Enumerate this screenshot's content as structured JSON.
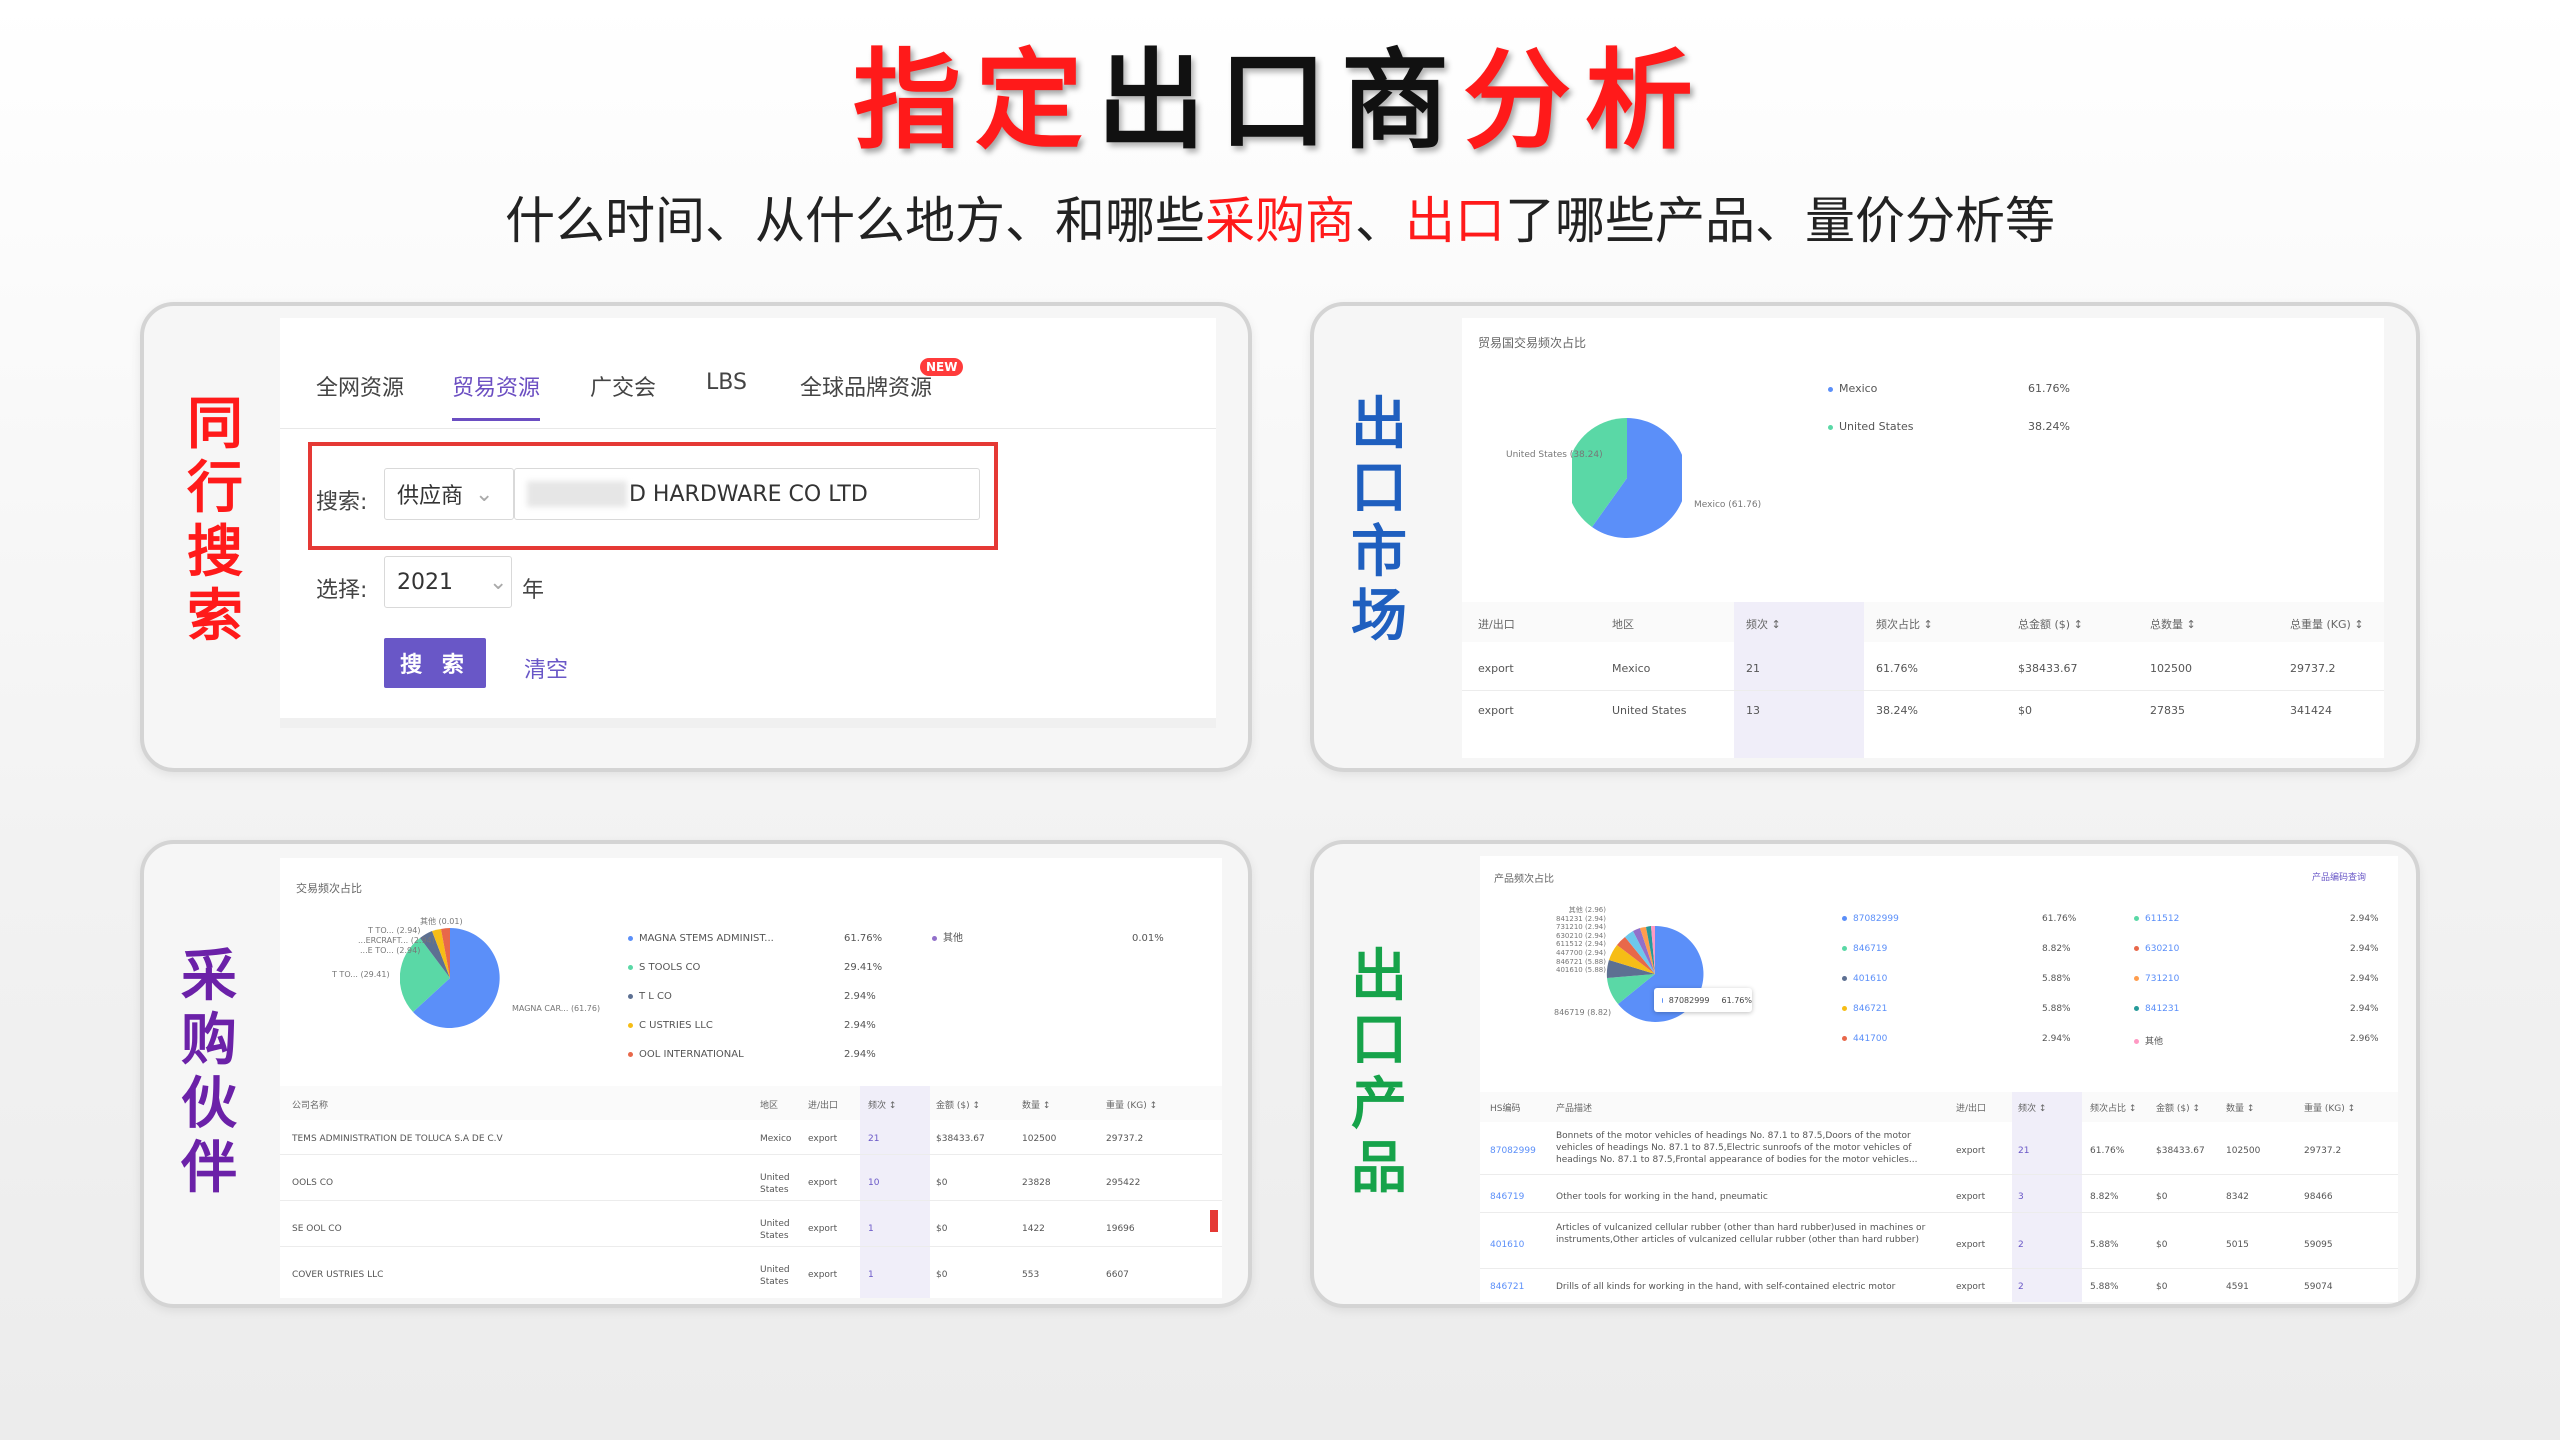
{
  "title": {
    "p1": "指定",
    "p2": "出口商",
    "p3": "分析"
  },
  "subtitle": {
    "p1": "什么时间、从什么地方、和哪些",
    "p2": "采购商",
    "p3": "、",
    "p4": "出口",
    "p5": "了哪些产品、量价分析等"
  },
  "labels": {
    "peer_search": "同行搜索",
    "export_market": "出口市场",
    "partners": "采购伙伴",
    "products": "出口产品"
  },
  "search": {
    "tabs": [
      "全网资源",
      "贸易资源",
      "广交会",
      "LBS",
      "全球品牌资源"
    ],
    "new_badge": "NEW",
    "search_label": "搜索:",
    "type_value": "供应商",
    "query_value": "D HARDWARE CO LTD",
    "select_label": "选择:",
    "year_value": "2021",
    "year_unit": "年",
    "search_button": "搜 索",
    "clear_link": "清空"
  },
  "market": {
    "chart_title": "贸易国交易频次占比",
    "legend": [
      {
        "name": "Mexico",
        "pct": "61.76%"
      },
      {
        "name": "United States",
        "pct": "38.24%"
      }
    ],
    "pie_label_left": "United States (38.24)",
    "pie_label_right": "Mexico (61.76)",
    "headers": [
      "进/出口",
      "地区",
      "频次",
      "频次占比",
      "总金额 ($)",
      "总数量",
      "总重量 (KG)"
    ],
    "rows": [
      [
        "export",
        "Mexico",
        "21",
        "61.76%",
        "$38433.67",
        "102500",
        "29737.2"
      ],
      [
        "export",
        "United States",
        "13",
        "38.24%",
        "$0",
        "27835",
        "341424"
      ]
    ]
  },
  "partners": {
    "chart_title": "交易频次占比",
    "legend": [
      {
        "name": "MAGNA  STEMS ADMINIST...",
        "pct": "61.76%"
      },
      {
        "name": "S  TOOLS CO",
        "pct": "29.41%"
      },
      {
        "name": "T  L CO",
        "pct": "2.94%"
      },
      {
        "name": "C  USTRIES LLC",
        "pct": "2.94%"
      },
      {
        "name": "OOL INTERNATIONAL",
        "pct": "2.94%"
      },
      {
        "name": "其他",
        "pct": "0.01%"
      }
    ],
    "pie_labels": [
      "其他 (0.01)",
      "T  TO... (2.94)",
      "...ERCRAFT... (2.94)",
      "...E TO... (2.94)",
      "T  TO... (29.41)",
      "MAGNA CAR... (61.76)"
    ],
    "headers": [
      "公司名称",
      "地区",
      "进/出口",
      "频次",
      "金额 ($)",
      "数量",
      "重量 (KG)"
    ],
    "rows": [
      [
        "TEMS ADMINISTRATION DE TOLUCA S.A DE C.V",
        "Mexico",
        "export",
        "21",
        "$38433.67",
        "102500",
        "29737.2"
      ],
      [
        "OOLS CO",
        "United States",
        "export",
        "10",
        "$0",
        "23828",
        "295422"
      ],
      [
        "SE  OOL CO",
        "United States",
        "export",
        "1",
        "$0",
        "1422",
        "19696"
      ],
      [
        "COVER  USTRIES LLC",
        "United States",
        "export",
        "1",
        "$0",
        "553",
        "6607"
      ]
    ]
  },
  "products": {
    "chart_title": "产品频次占比",
    "link": "产品编码查询",
    "tooltip": {
      "code": "87082999",
      "pct": "61.76%"
    },
    "pie_labels": [
      "其他 (2.96)",
      "841231 (2.94)",
      "731210 (2.94)",
      "630210 (2.94)",
      "611512 (2.94)",
      "447700 (2.94)",
      "846721 (5.88)",
      "401610 (5.88)",
      "846719 (8.82)"
    ],
    "legend": [
      {
        "code": "87082999",
        "pct": "61.76%",
        "code2": "611512",
        "pct2": "2.94%",
        "c1": "#5b8ff9",
        "c2": "#5ad8a6"
      },
      {
        "code": "846719",
        "pct": "8.82%",
        "code2": "630210",
        "pct2": "2.94%",
        "c1": "#5ad8a6",
        "c2": "#e8684a"
      },
      {
        "code": "401610",
        "pct": "5.88%",
        "code2": "731210",
        "pct2": "2.94%",
        "c1": "#5d7092",
        "c2": "#ff9d4d"
      },
      {
        "code": "846721",
        "pct": "5.88%",
        "code2": "841231",
        "pct2": "2.94%",
        "c1": "#f6bd16",
        "c2": "#269a99"
      },
      {
        "code": "441700",
        "pct": "2.94%",
        "code2": "其他",
        "pct2": "2.96%",
        "c1": "#e8684a",
        "c2": "#ff99c3"
      }
    ],
    "headers": [
      "HS编码",
      "产品描述",
      "进/出口",
      "频次",
      "频次占比",
      "金额 ($)",
      "数量",
      "重量 (KG)"
    ],
    "rows": [
      [
        "87082999",
        "Bonnets of the motor vehicles of headings No. 87.1 to 87.5,Doors of the motor vehicles of headings No. 87.1 to 87.5,Electric sunroofs of the motor vehicles of headings No. 87.1 to 87.5,Frontal appearance of bodies for the motor vehicles...",
        "export",
        "21",
        "61.76%",
        "$38433.67",
        "102500",
        "29737.2"
      ],
      [
        "846719",
        "Other tools for working in the hand, pneumatic",
        "export",
        "3",
        "8.82%",
        "$0",
        "8342",
        "98466"
      ],
      [
        "401610",
        "Articles of vulcanized cellular rubber (other than hard rubber)used in machines or instruments,Other articles of vulcanized cellular rubber (other than hard rubber)",
        "export",
        "2",
        "5.88%",
        "$0",
        "5015",
        "59095"
      ],
      [
        "846721",
        "Drills of all kinds for working in the hand, with self-contained electric motor",
        "export",
        "2",
        "5.88%",
        "$0",
        "4591",
        "59074"
      ]
    ]
  },
  "colors": {
    "accent_red": "#ff1a1a",
    "purple": "#6957c7",
    "label_blue": "#1f5fbf",
    "label_green": "#16a34a",
    "label_purple": "#6b21a8"
  }
}
